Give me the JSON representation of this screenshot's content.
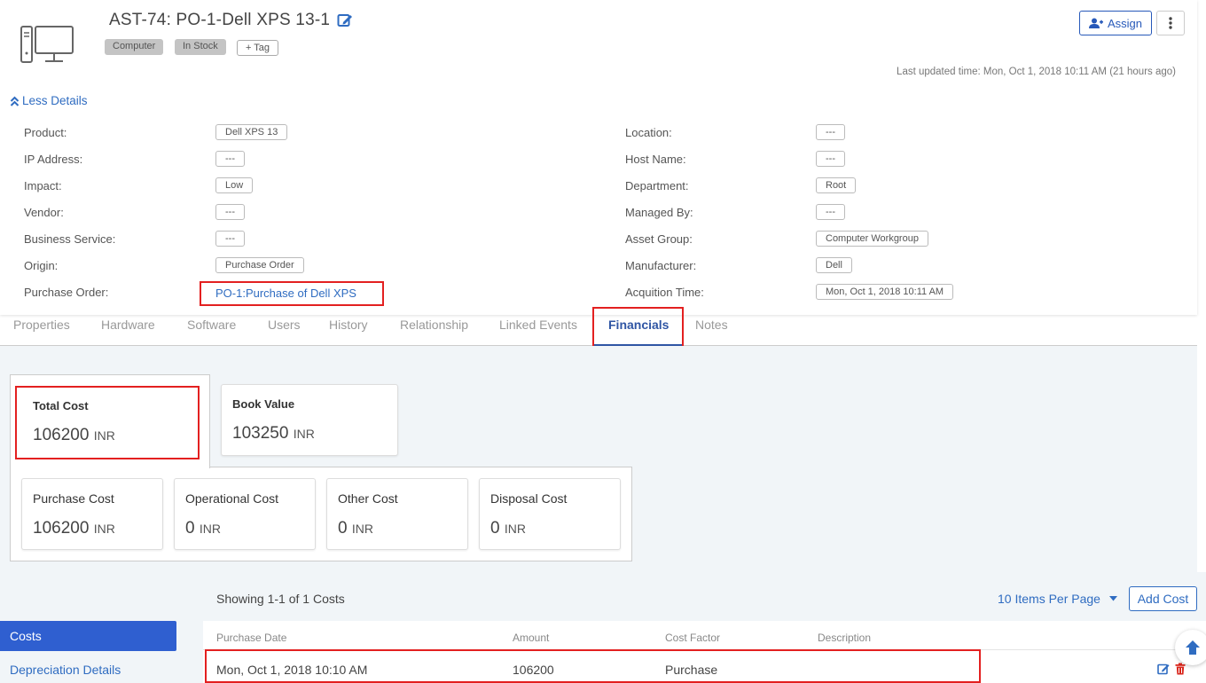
{
  "asset": {
    "title": "AST-74: PO-1-Dell XPS 13-1",
    "tags": [
      "Computer",
      "In Stock"
    ],
    "add_tag_label": "+ Tag",
    "assign_label": "Assign",
    "last_updated": "Last updated time: Mon, Oct 1, 2018 10:11 AM (21 hours ago)",
    "less_details_label": "Less Details"
  },
  "properties_left": [
    {
      "label": "Product:",
      "value": "Dell XPS 13"
    },
    {
      "label": "IP Address:",
      "value": "---"
    },
    {
      "label": "Impact:",
      "value": "Low"
    },
    {
      "label": "Vendor:",
      "value": "---"
    },
    {
      "label": "Business Service:",
      "value": "---"
    },
    {
      "label": "Origin:",
      "value": "Purchase Order"
    },
    {
      "label": "Purchase Order:",
      "value": "PO-1:Purchase of Dell XPS"
    }
  ],
  "properties_right": [
    {
      "label": "Location:",
      "value": "---"
    },
    {
      "label": "Host Name:",
      "value": "---"
    },
    {
      "label": "Department:",
      "value": "Root"
    },
    {
      "label": "Managed By:",
      "value": "---"
    },
    {
      "label": "Asset Group:",
      "value": "Computer Workgroup"
    },
    {
      "label": "Manufacturer:",
      "value": "Dell"
    },
    {
      "label": "Acquition Time:",
      "value": "Mon, Oct 1, 2018 10:11 AM"
    }
  ],
  "tabs": [
    "Properties",
    "Hardware",
    "Software",
    "Users",
    "History",
    "Relationship",
    "Linked Events",
    "Financials",
    "Notes"
  ],
  "active_tab": "Financials",
  "summary": {
    "total": {
      "title": "Total Cost",
      "amount": "106200",
      "currency": "INR"
    },
    "book": {
      "title": "Book Value",
      "amount": "103250",
      "currency": "INR"
    }
  },
  "costs": [
    {
      "title": "Purchase Cost",
      "amount": "106200",
      "currency": "INR"
    },
    {
      "title": "Operational Cost",
      "amount": "0",
      "currency": "INR"
    },
    {
      "title": "Other Cost",
      "amount": "0",
      "currency": "INR"
    },
    {
      "title": "Disposal Cost",
      "amount": "0",
      "currency": "INR"
    }
  ],
  "sidebar": {
    "active": "Costs",
    "link": "Depreciation Details"
  },
  "list": {
    "showing": "Showing 1-1 of 1 Costs",
    "per_page": "10 Items Per Page",
    "add_label": "Add Cost",
    "columns": [
      "Purchase Date",
      "Amount",
      "Cost Factor",
      "Description"
    ],
    "rows": [
      {
        "date": "Mon, Oct 1, 2018 10:10 AM",
        "amount": "106200",
        "factor": "Purchase",
        "description": ""
      }
    ]
  },
  "colors": {
    "accent": "#2f55a4",
    "link": "#2f6cc1",
    "highlight": "#e32020",
    "delete": "#d9261c"
  }
}
